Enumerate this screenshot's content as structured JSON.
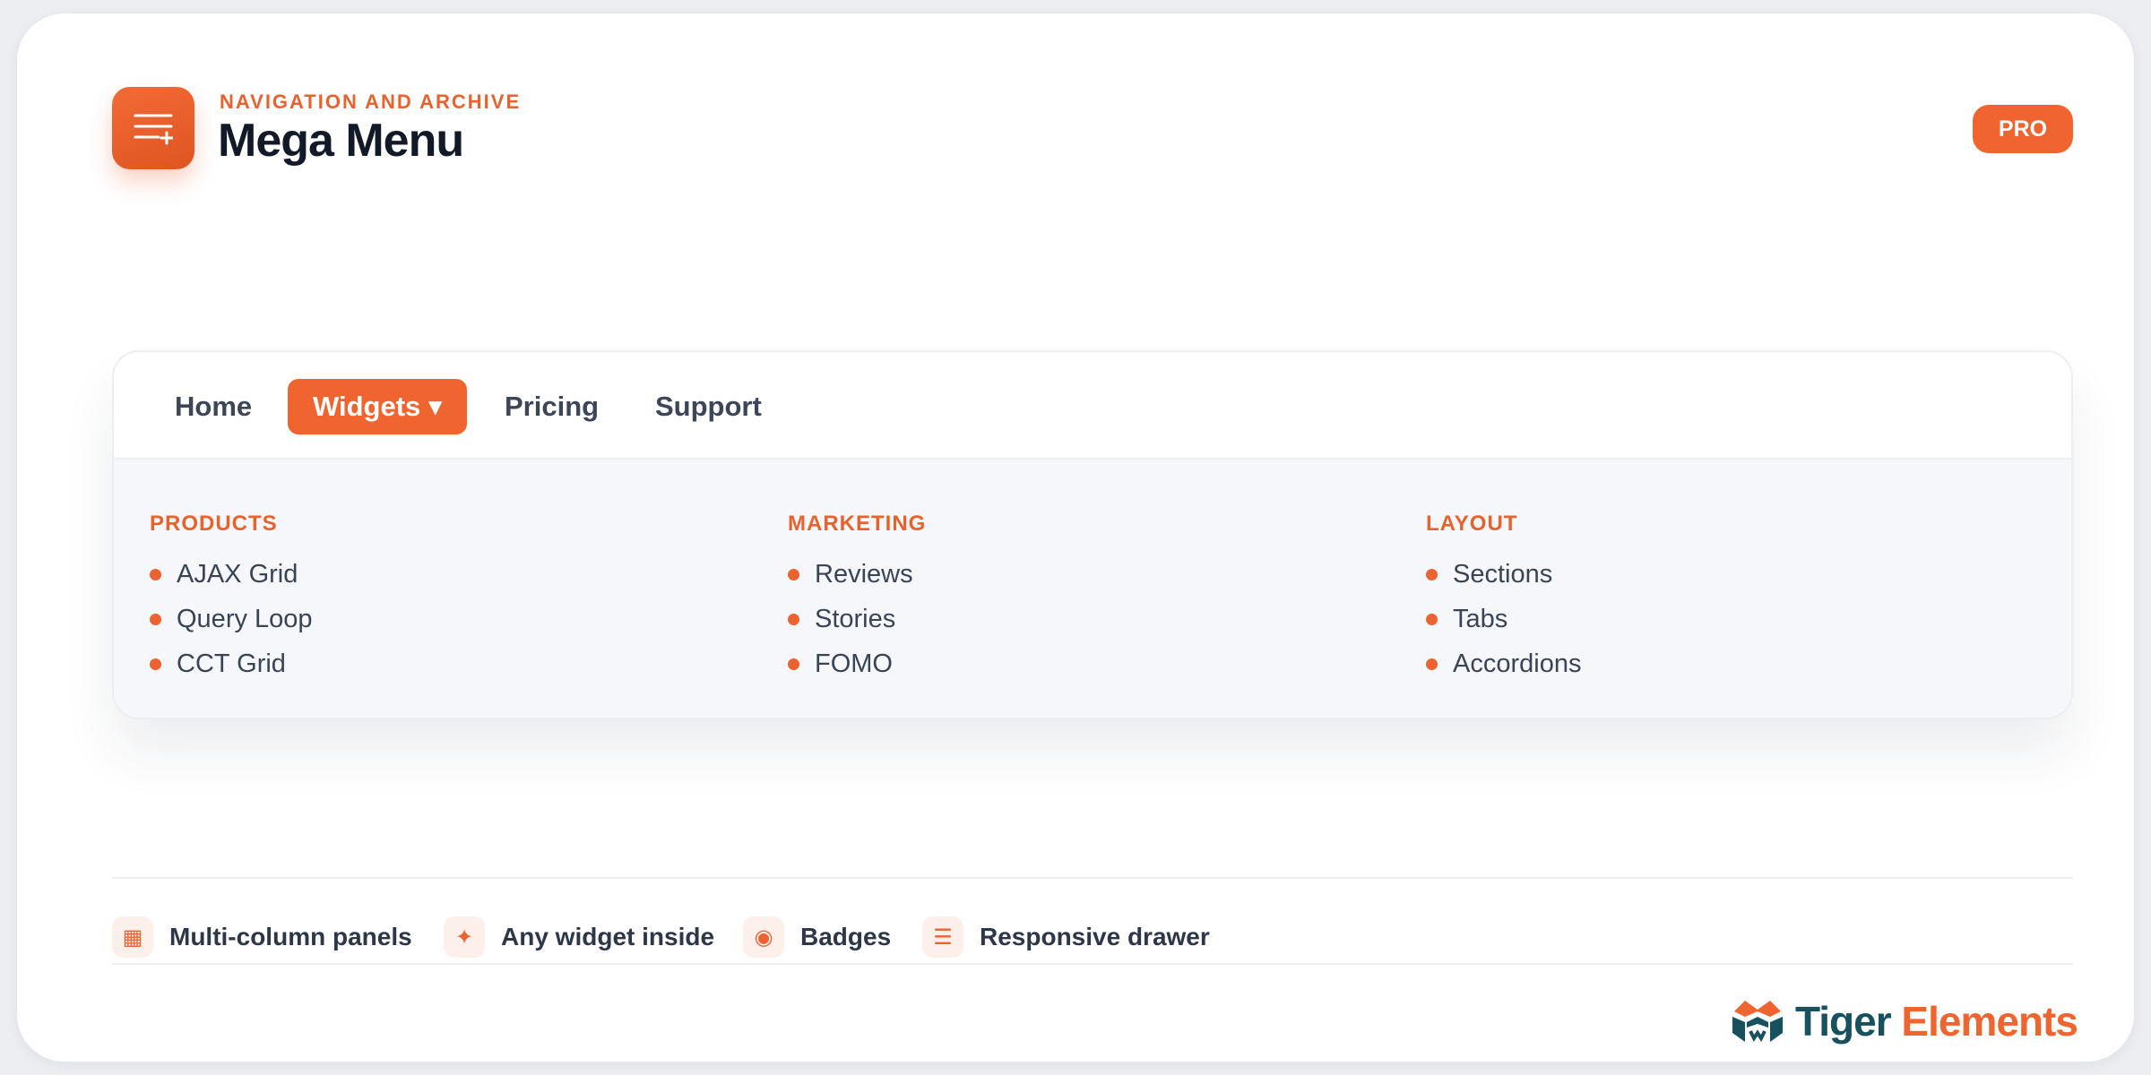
{
  "header": {
    "eyebrow": "NAVIGATION AND ARCHIVE",
    "title": "Mega Menu",
    "badge": "PRO",
    "icon": "menu-plus-icon"
  },
  "nav": {
    "items": [
      {
        "label": "Home",
        "active": false
      },
      {
        "label": "Widgets ▾",
        "active": true
      },
      {
        "label": "Pricing",
        "active": false
      },
      {
        "label": "Support",
        "active": false
      }
    ]
  },
  "dropdown": {
    "columns": [
      {
        "title": "PRODUCTS",
        "items": [
          "AJAX Grid",
          "Query Loop",
          "CCT Grid"
        ]
      },
      {
        "title": "MARKETING",
        "items": [
          "Reviews",
          "Stories",
          "FOMO"
        ]
      },
      {
        "title": "LAYOUT",
        "items": [
          "Sections",
          "Tabs",
          "Accordions"
        ]
      }
    ]
  },
  "features": [
    {
      "icon": "grid-icon",
      "glyph": "▦",
      "label": "Multi-column panels"
    },
    {
      "icon": "sparkle-icon",
      "glyph": "✦",
      "label": "Any widget inside"
    },
    {
      "icon": "badge-icon",
      "glyph": "◉",
      "label": "Badges"
    },
    {
      "icon": "drawer-icon",
      "glyph": "☰",
      "label": "Responsive drawer"
    }
  ],
  "brand": {
    "name_part1": "Tiger",
    "name_part2": "Elements",
    "colors": {
      "primary": "#17515d",
      "accent": "#f0652f"
    }
  },
  "colors": {
    "accent": "#f0652f",
    "text_dark": "#131a27",
    "panel_bg": "#f5f7fa"
  }
}
